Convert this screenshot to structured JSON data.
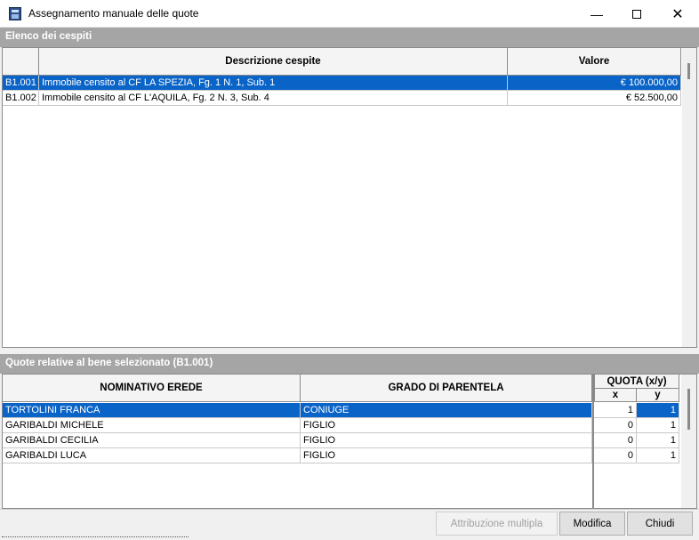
{
  "window": {
    "title": "Assegnamento manuale delle quote"
  },
  "assets": {
    "header": "Elenco dei cespiti",
    "columns": {
      "code": "",
      "description": "Descrizione cespite",
      "value": "Valore"
    },
    "rows": [
      {
        "code": "B1.001",
        "description": "Immobile censito al CF LA SPEZIA, Fg. 1 N. 1, Sub. 1",
        "value": "€ 100.000,00",
        "selected": true
      },
      {
        "code": "B1.002",
        "description": "Immobile censito al CF L'AQUILA, Fg. 2 N. 3, Sub. 4",
        "value": "€ 52.500,00",
        "selected": false
      }
    ]
  },
  "quotes": {
    "header": "Quote relative al bene selezionato (B1.001)",
    "columns": {
      "heir": "NOMINATIVO EREDE",
      "relation": "GRADO DI PARENTELA",
      "quota": "QUOTA (x/y)",
      "x": "x",
      "y": "y"
    },
    "rows": [
      {
        "heir": "TORTOLINI FRANCA",
        "relation": "CONIUGE",
        "x": "1",
        "y": "1",
        "selected": true
      },
      {
        "heir": "GARIBALDI MICHELE",
        "relation": "FIGLIO",
        "x": "0",
        "y": "1",
        "selected": false
      },
      {
        "heir": "GARIBALDI CECILIA",
        "relation": "FIGLIO",
        "x": "0",
        "y": "1",
        "selected": false
      },
      {
        "heir": "GARIBALDI LUCA",
        "relation": "FIGLIO",
        "x": "0",
        "y": "1",
        "selected": false
      }
    ]
  },
  "buttons": {
    "multiple": "Attribuzione multipla",
    "edit": "Modifica",
    "close": "Chiudi"
  },
  "colors": {
    "selection": "#0a64c8",
    "section_header": "#a5a5a5"
  }
}
